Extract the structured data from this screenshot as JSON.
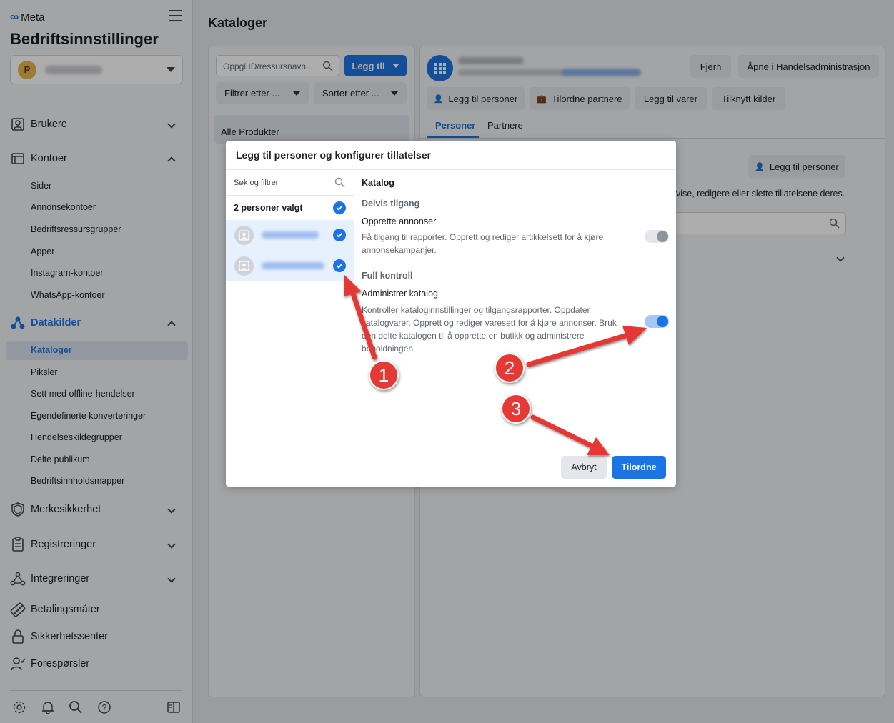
{
  "brand": {
    "logo_text": "Meta"
  },
  "sidebar": {
    "title": "Bedriftsinnstillinger",
    "account": {
      "avatar_letter": "P"
    },
    "sections": [
      {
        "label": "Brukere",
        "expanded": false
      },
      {
        "label": "Kontoer",
        "expanded": true
      },
      {
        "label": "Datakilder",
        "expanded": true,
        "active": true
      },
      {
        "label": "Merkesikkerhet",
        "expanded": false
      },
      {
        "label": "Registreringer",
        "expanded": false
      },
      {
        "label": "Integreringer",
        "expanded": false
      },
      {
        "label": "Betalingsmåter"
      },
      {
        "label": "Sikkerhetssenter"
      },
      {
        "label": "Forespørsler"
      }
    ],
    "kontoer_items": [
      "Sider",
      "Annonsekontoer",
      "Bedriftsressursgrupper",
      "Apper",
      "Instagram-kontoer",
      "WhatsApp-kontoer"
    ],
    "datakilder_items": [
      "Kataloger",
      "Piksler",
      "Sett med offline-hendelser",
      "Egendefinerte konverteringer",
      "Hendelseskildegrupper",
      "Delte publikum",
      "Bedriftsinnholdsmapper"
    ],
    "active_item": "Kataloger"
  },
  "main": {
    "page_title": "Kataloger",
    "search_placeholder": "Oppgi ID/ressursnavn...",
    "add_button": "Legg til",
    "filter_label": "Filtrer etter ...",
    "sort_label": "Sorter etter ...",
    "catalog_item": "Alle Produkter",
    "actions": {
      "remove": "Fjern",
      "open_commerce": "Åpne i Handelsadministrasjon",
      "add_people": "Legg til personer",
      "assign_partners": "Tilordne partnere",
      "add_items": "Legg til varer",
      "connect_sources": "Tilknytt kilder"
    },
    "tabs": [
      "Personer",
      "Partnere"
    ],
    "active_tab": "Personer",
    "people_button": "Legg til personer",
    "people_info_partial": "vise, redigere eller slette tillatelsene deres."
  },
  "modal": {
    "title": "Legg til personer og konfigurer tillatelser",
    "search_label": "Søk og filtrer",
    "selected_label": "2 personer valgt",
    "section_heading": "Katalog",
    "partial_access": "Delvis tilgang",
    "perm1_title": "Opprette annonser",
    "perm1_desc": "Få tilgang til rapporter. Opprett og rediger artikkelsett for å kjøre annonsekampanjer.",
    "perm1_enabled": false,
    "full_control": "Full kontroll",
    "perm2_title": "Administrer katalog",
    "perm2_desc": "Kontroller kataloginnstillinger og tilgangsrapporter. Oppdater katalogvarer. Opprett og rediger varesett for å kjøre annonser. Bruk den delte katalogen til å opprette en butikk og administrere beholdningen.",
    "perm2_enabled": true,
    "cancel_button": "Avbryt",
    "assign_button": "Tilordne"
  },
  "annotations": {
    "badge1": "1",
    "badge2": "2",
    "badge3": "3",
    "color": "#e53935"
  },
  "colors": {
    "accent": "#1b74e4",
    "sidebar_bg": "#f0f2f5"
  }
}
